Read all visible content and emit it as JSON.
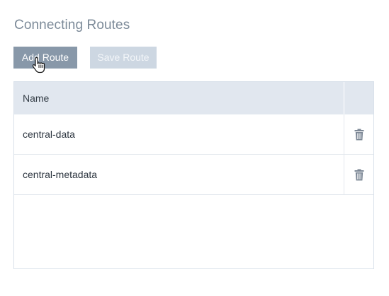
{
  "section": {
    "title": "Connecting Routes"
  },
  "toolbar": {
    "add_label": "Add Route",
    "save_label": "Save Route"
  },
  "table": {
    "column_name": "Name",
    "rows": [
      {
        "name": "central-data",
        "action_icon": "trash-icon"
      },
      {
        "name": "central-metadata",
        "action_icon": "trash-icon"
      }
    ]
  },
  "colors": {
    "primary_button": "#8898a9",
    "disabled_button": "#cdd7e2",
    "header_bg": "#e1e7ef",
    "icon": "#7d8896"
  }
}
